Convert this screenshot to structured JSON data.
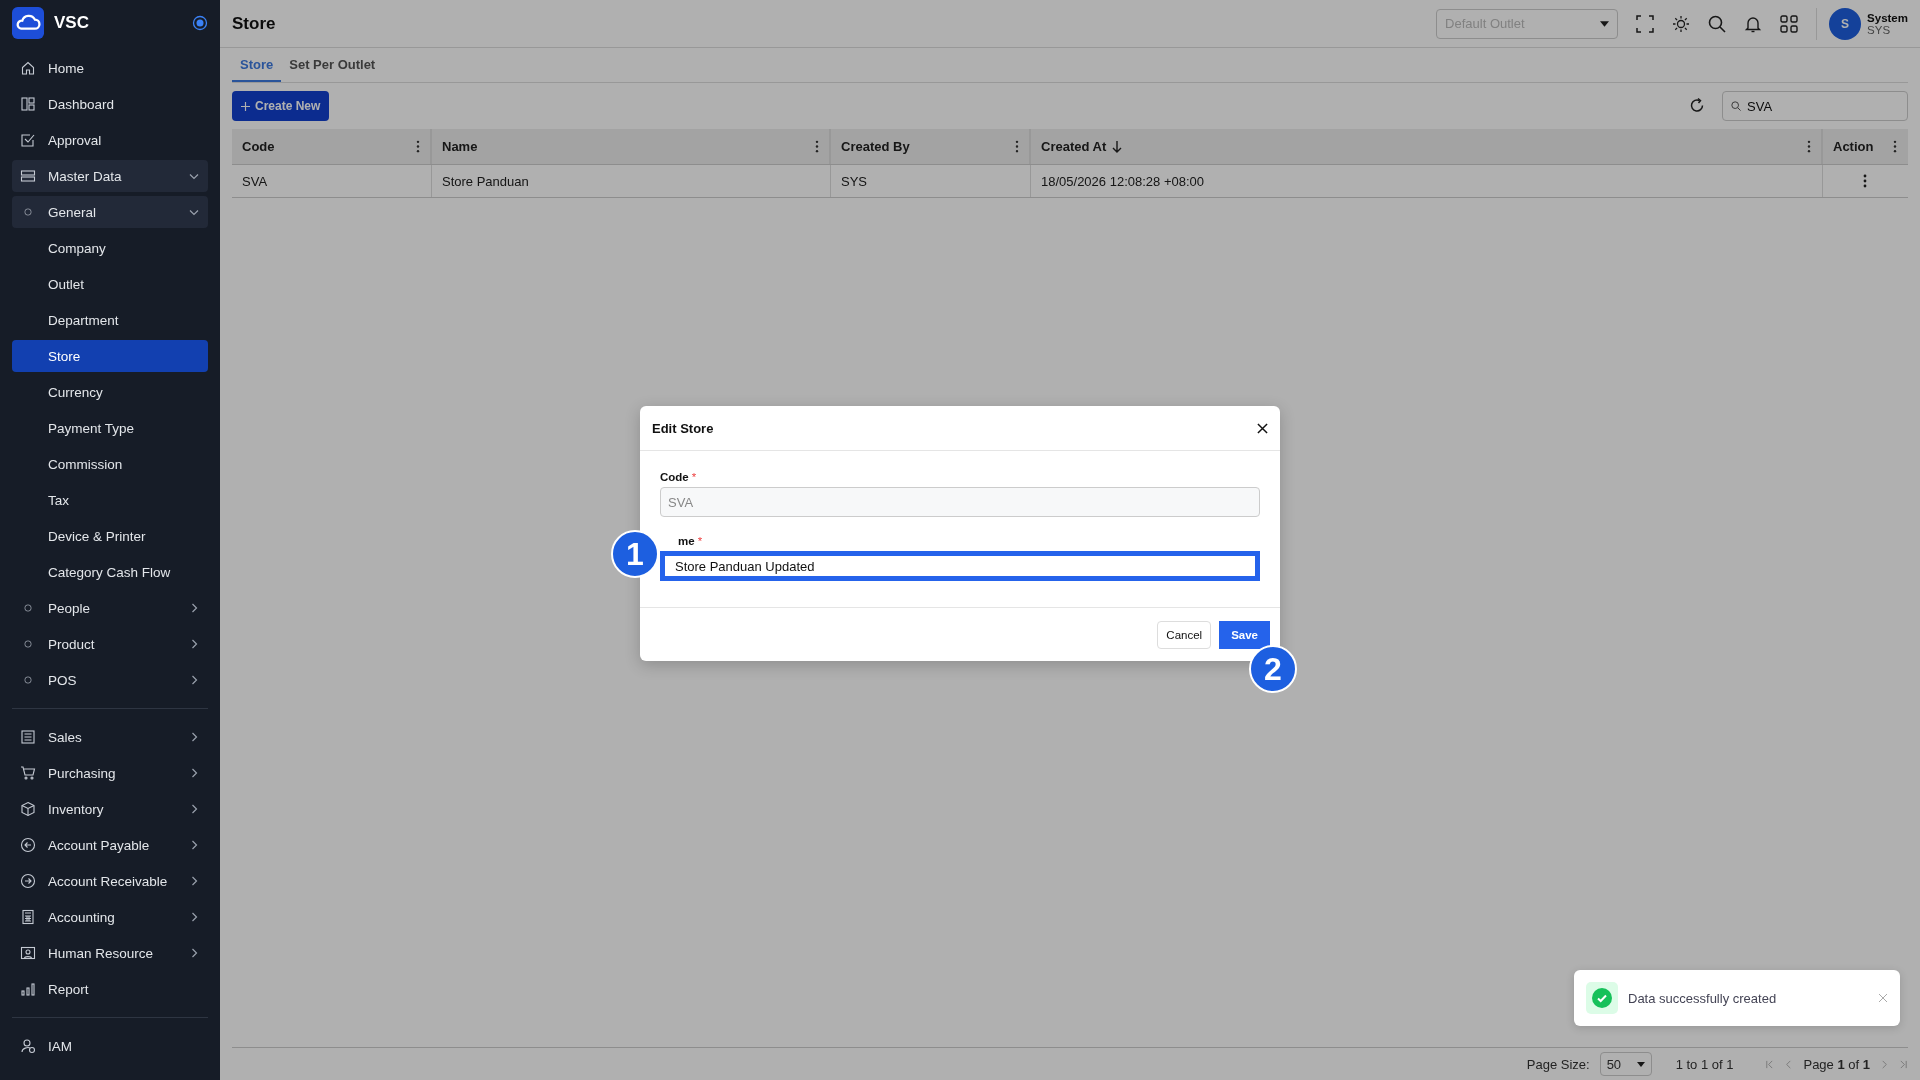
{
  "brand": {
    "name": "VSC"
  },
  "sidebar": {
    "items": [
      {
        "label": "Home",
        "kind": "link",
        "selected": false
      },
      {
        "label": "Dashboard",
        "kind": "link",
        "selected": false
      },
      {
        "label": "Approval",
        "kind": "link",
        "selected": false
      },
      {
        "label": "Master Data",
        "kind": "group",
        "expanded": true,
        "selected": false,
        "children": [
          {
            "label": "General",
            "kind": "group",
            "expanded": true,
            "selected": false,
            "children": [
              {
                "label": "Company",
                "kind": "link",
                "selected": false
              },
              {
                "label": "Outlet",
                "kind": "link",
                "selected": false
              },
              {
                "label": "Department",
                "kind": "link",
                "selected": false
              },
              {
                "label": "Store",
                "kind": "link",
                "selected": true
              },
              {
                "label": "Currency",
                "kind": "link",
                "selected": false
              },
              {
                "label": "Payment Type",
                "kind": "link",
                "selected": false
              },
              {
                "label": "Commission",
                "kind": "link",
                "selected": false
              },
              {
                "label": "Tax",
                "kind": "link",
                "selected": false
              },
              {
                "label": "Device & Printer",
                "kind": "link",
                "selected": false
              },
              {
                "label": "Category Cash Flow",
                "kind": "link",
                "selected": false
              }
            ]
          },
          {
            "label": "People",
            "kind": "group",
            "expanded": false,
            "selected": false
          },
          {
            "label": "Product",
            "kind": "group",
            "expanded": false,
            "selected": false
          },
          {
            "label": "POS",
            "kind": "group",
            "expanded": false,
            "selected": false
          }
        ]
      },
      {
        "kind": "divider"
      },
      {
        "label": "Sales",
        "kind": "group",
        "expanded": false,
        "selected": false
      },
      {
        "label": "Purchasing",
        "kind": "group",
        "expanded": false,
        "selected": false
      },
      {
        "label": "Inventory",
        "kind": "group",
        "expanded": false,
        "selected": false
      },
      {
        "label": "Account Payable",
        "kind": "group",
        "expanded": false,
        "selected": false
      },
      {
        "label": "Account Receivable",
        "kind": "group",
        "expanded": false,
        "selected": false
      },
      {
        "label": "Accounting",
        "kind": "group",
        "expanded": false,
        "selected": false
      },
      {
        "label": "Human Resource",
        "kind": "group",
        "expanded": false,
        "selected": false
      },
      {
        "label": "Report",
        "kind": "link",
        "selected": false
      },
      {
        "kind": "divider"
      },
      {
        "label": "IAM",
        "kind": "link",
        "selected": false
      }
    ]
  },
  "header": {
    "title": "Store",
    "outlet_select": {
      "placeholder": "Default Outlet"
    },
    "user": {
      "initial": "S",
      "name": "System",
      "code": "SYS"
    }
  },
  "tabs": [
    {
      "label": "Store",
      "selected": true
    },
    {
      "label": "Set Per Outlet",
      "selected": false
    }
  ],
  "toolbar": {
    "create_button": "Create New",
    "search": {
      "value": "SVA"
    }
  },
  "table": {
    "columns": [
      {
        "label": "Code",
        "sorted_desc": false
      },
      {
        "label": "Name",
        "sorted_desc": false
      },
      {
        "label": "Created By",
        "sorted_desc": false
      },
      {
        "label": "Created At",
        "sorted_desc": true
      },
      {
        "label": "Action",
        "sorted_desc": false
      }
    ],
    "rows": [
      {
        "cells": [
          "SVA",
          "Store Panduan",
          "SYS",
          "18/05/2026 12:08:28 +08:00"
        ]
      }
    ]
  },
  "pagination": {
    "page_size_label": "Page Size:",
    "page_size": "50",
    "range": "1 to 1 of 1",
    "page_prefix": "Page",
    "page": "1",
    "page_of": "of",
    "page_total": "1"
  },
  "dialog": {
    "title": "Edit Store",
    "fields": [
      {
        "label": "Code",
        "required_mark": "*",
        "value": "SVA",
        "disabled": true,
        "highlighted": false
      },
      {
        "label": "me",
        "required_mark": "*",
        "value": "Store Panduan Updated",
        "disabled": false,
        "highlighted": true
      }
    ],
    "buttons": [
      "Cancel",
      "Save"
    ]
  },
  "annotations": [
    {
      "text": "1"
    },
    {
      "text": "2"
    }
  ],
  "toast": {
    "message": "Data successfully created"
  }
}
